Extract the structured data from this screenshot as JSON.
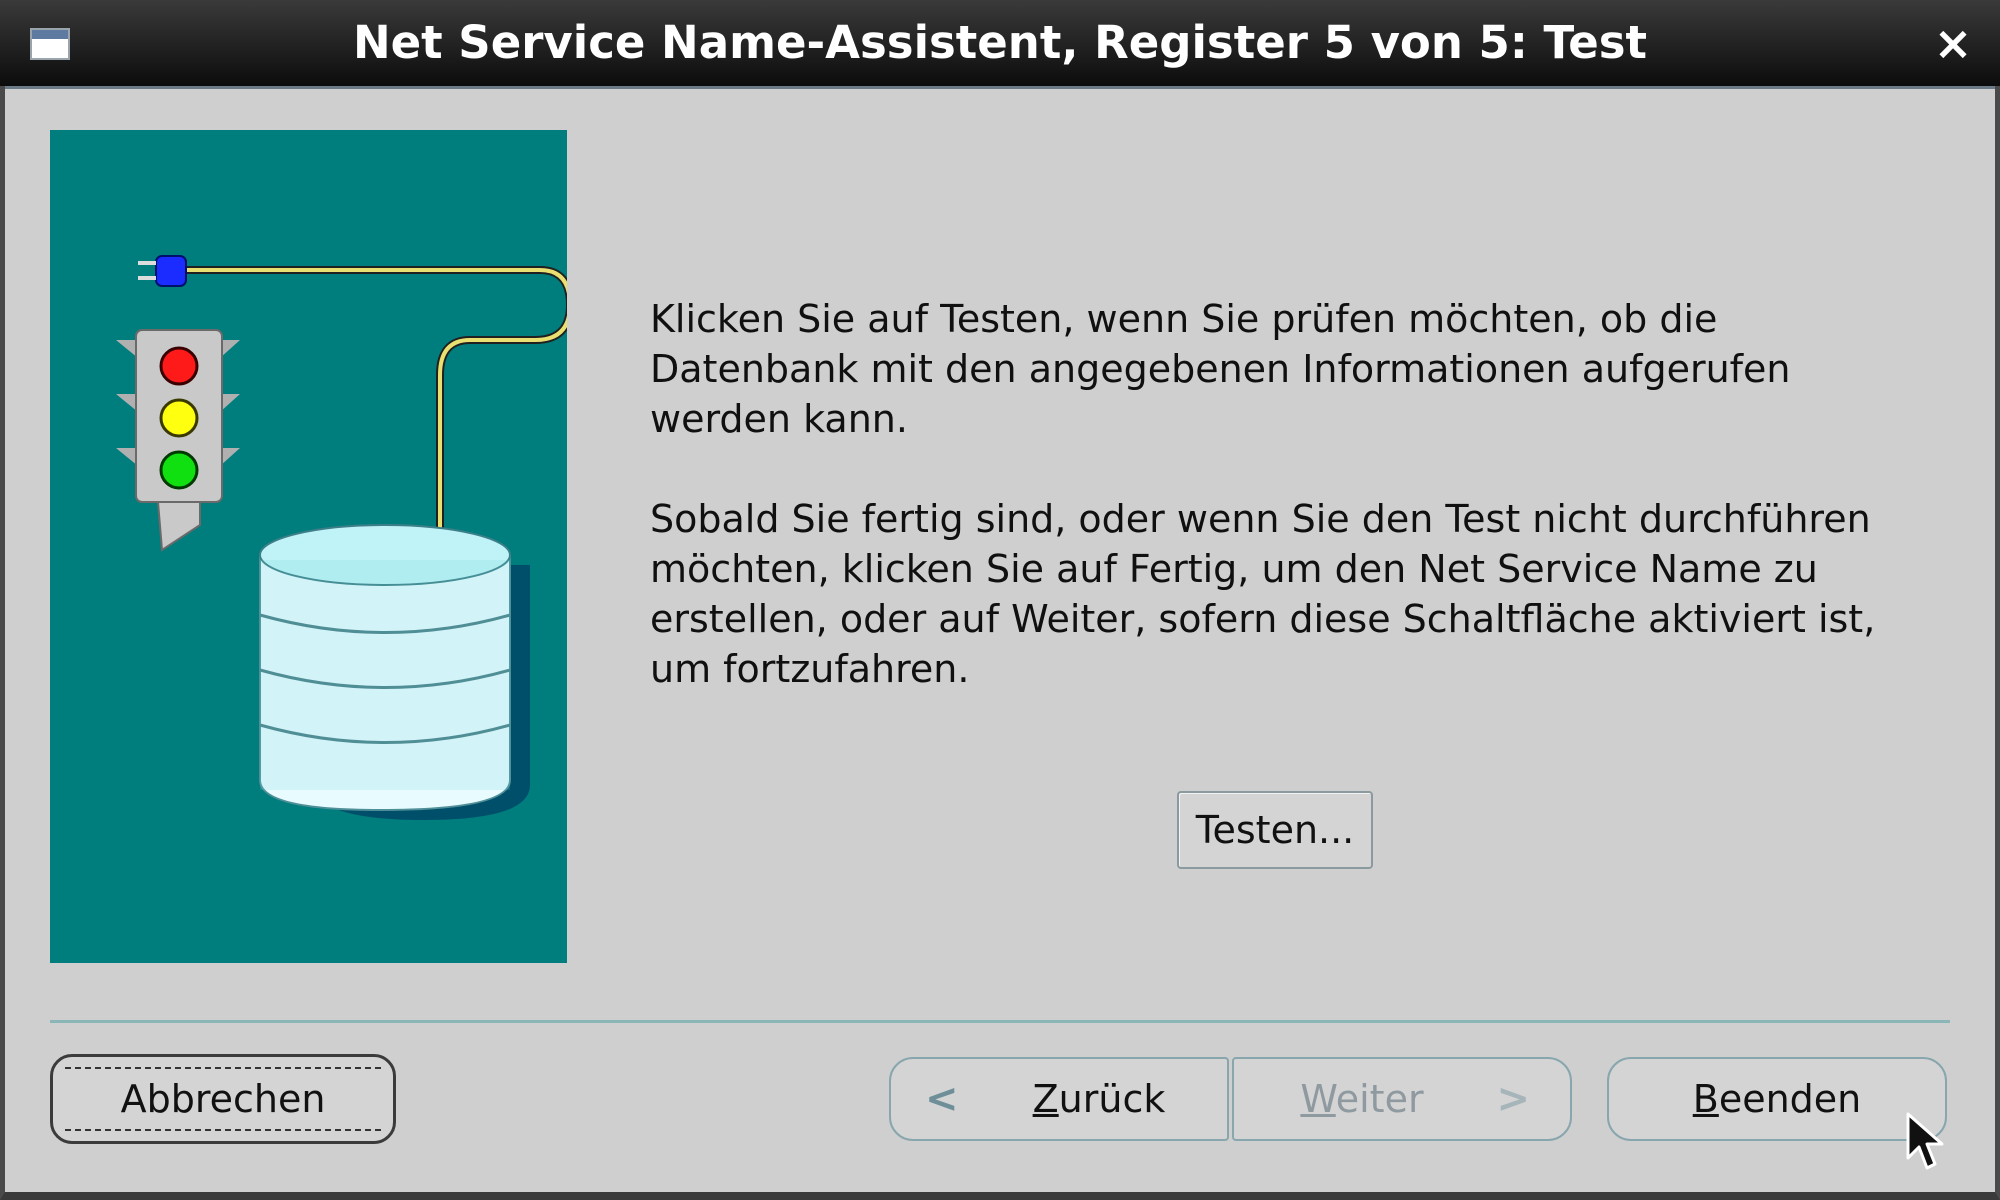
{
  "window": {
    "title": "Net Service Name-Assistent, Register 5 von 5: Test",
    "close_glyph": "×",
    "icon": "window-icon"
  },
  "content": {
    "paragraph1": "Klicken Sie auf Testen, wenn Sie prüfen möchten, ob die Datenbank mit den angegebenen Informationen aufgerufen werden kann.",
    "paragraph2": "Sobald Sie fertig sind, oder wenn Sie den Test nicht durchführen möchten, klicken Sie auf Fertig, um den Net Service Name zu erstellen, oder auf Weiter, sofern diese Schaltfläche aktiviert ist, um fortzufahren.",
    "test_button": "Testen..."
  },
  "illustration": {
    "icon": "traffic-light-database-icon",
    "background_color": "#007d7d"
  },
  "footer": {
    "cancel": "Abbrechen",
    "back_mnemonic": "Z",
    "back_rest": "urück",
    "next_mnemonic": "W",
    "next_rest": "eiter",
    "finish_mnemonic": "B",
    "finish_rest": "eenden",
    "back_chevron": "<",
    "next_chevron": ">"
  }
}
